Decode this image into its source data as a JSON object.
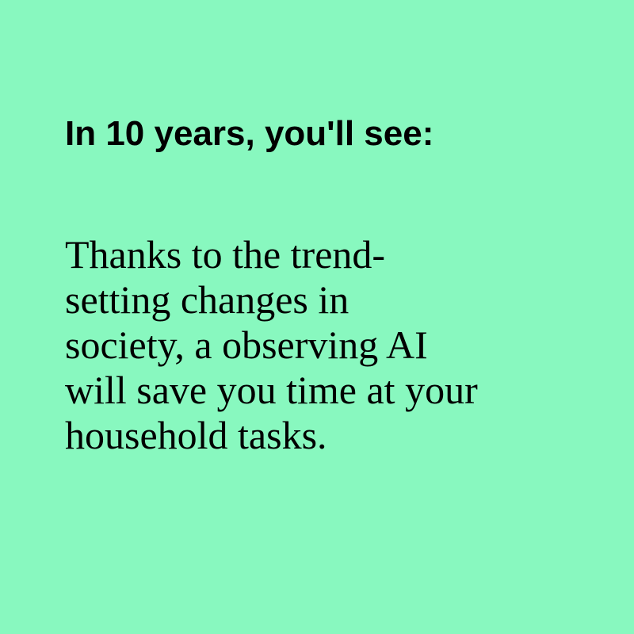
{
  "colors": {
    "background": "#88f8bf",
    "text": "#000000"
  },
  "headline": "In 10 years, you'll see:",
  "body": {
    "lines": [
      "Thanks to the trend-",
      "setting changes in",
      "society, a observing AI",
      "will save you time at your",
      "household tasks."
    ]
  }
}
